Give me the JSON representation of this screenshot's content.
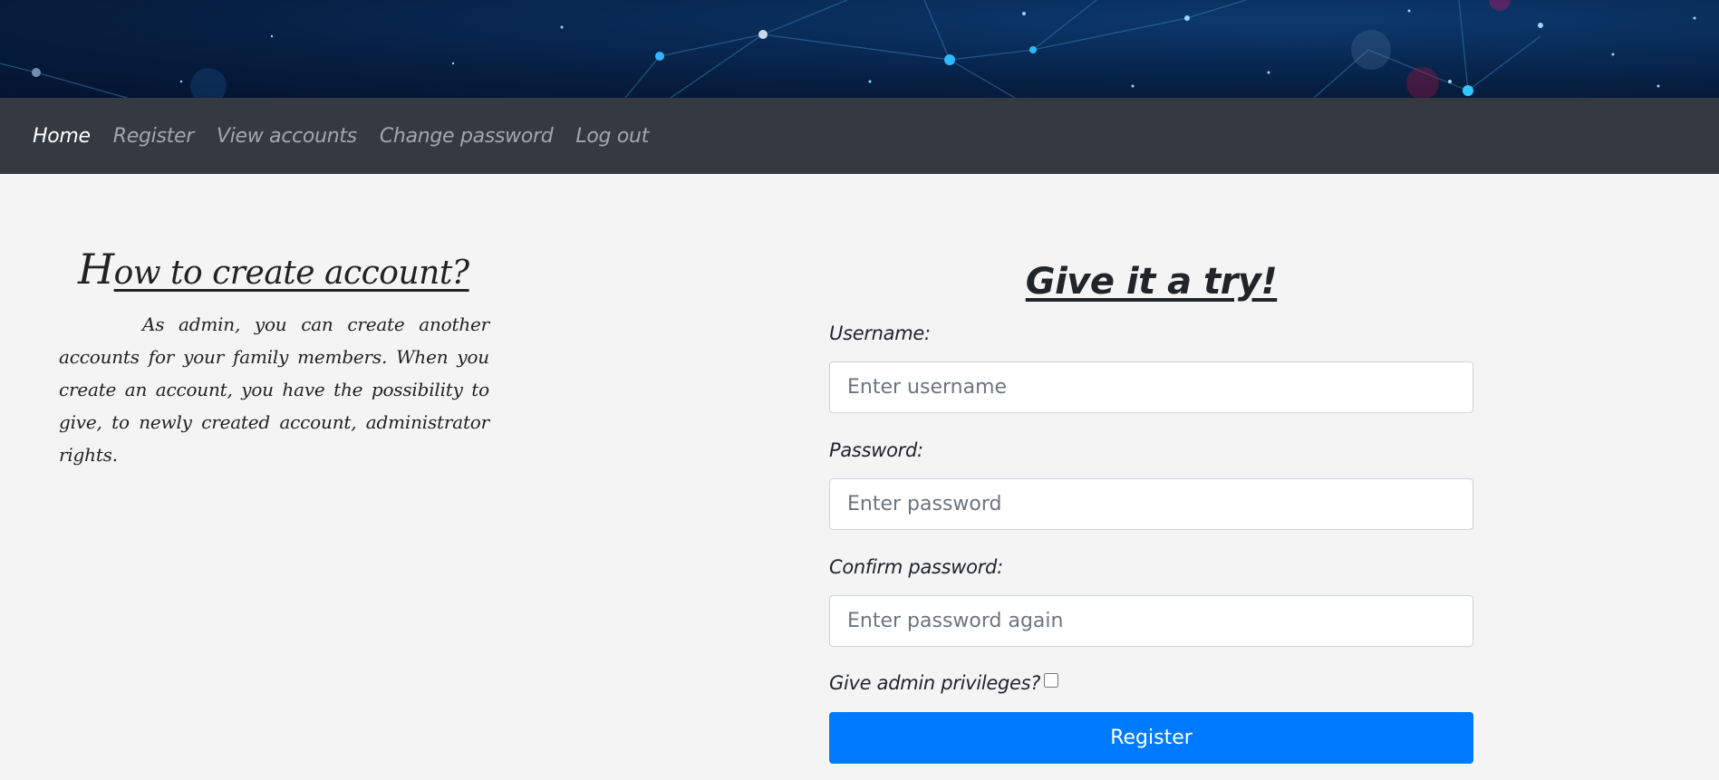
{
  "nav": {
    "items": [
      {
        "label": "Home",
        "active": true
      },
      {
        "label": "Register",
        "active": false
      },
      {
        "label": "View accounts",
        "active": false
      },
      {
        "label": "Change password",
        "active": false
      },
      {
        "label": "Log out",
        "active": false
      }
    ]
  },
  "info": {
    "title_initial": "H",
    "title_rest": "ow to create account?",
    "paragraph": "As admin, you can create another accounts for your family members. When you create an account, you have the possibility to give, to newly created account, administrator rights."
  },
  "form": {
    "title": "Give it a try!",
    "username_label": "Username:",
    "username_placeholder": "Enter username",
    "password_label": "Password:",
    "password_placeholder": "Enter password",
    "confirm_label": "Confirm password:",
    "confirm_placeholder": "Enter password again",
    "admin_label": "Give admin privileges?",
    "admin_checked": false,
    "submit_label": "Register"
  },
  "colors": {
    "navbar": "#343a40",
    "page_bg": "#f4f4f4",
    "primary_button": "#007bff",
    "banner": "#061d3e"
  }
}
